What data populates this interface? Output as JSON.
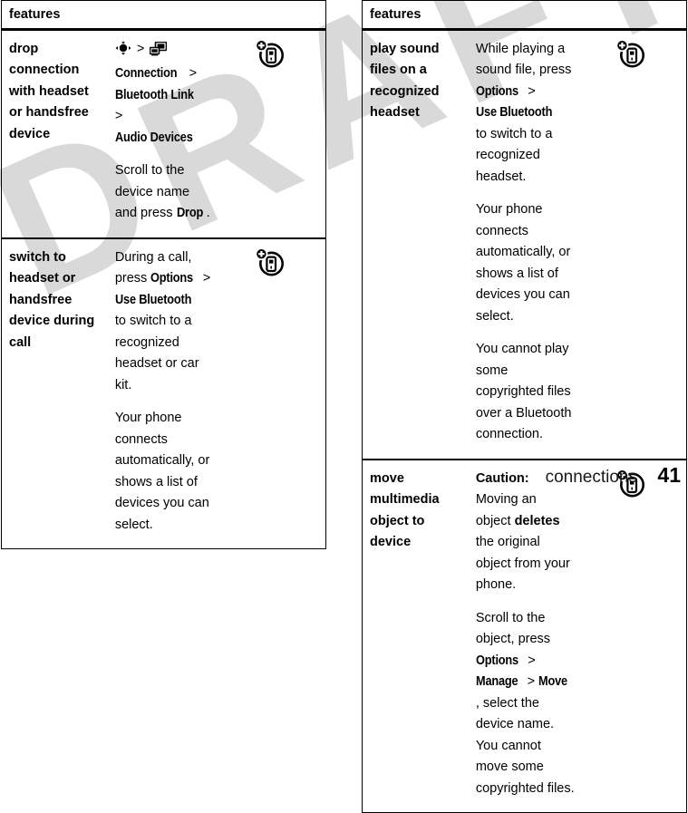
{
  "document": {
    "watermark_text": "DRAFT",
    "watermark_color": "#d9d9d9"
  },
  "footer": {
    "chapter": "connections",
    "page_number": "41"
  },
  "left_table": {
    "header": "features",
    "rows": [
      {
        "term": "drop connection with headset or handsfree device",
        "icon": "phone-plus-icon",
        "paragraphs": [
          {
            "segments": [
              {
                "type": "icon",
                "name": "navigation-key-icon"
              },
              {
                "type": "plain",
                "text": " > "
              },
              {
                "type": "icon",
                "name": "connection-icon"
              },
              {
                "type": "ui",
                "text": "Connection"
              },
              {
                "type": "plain",
                "text": " "
              },
              {
                "type": "plain",
                "text": "> "
              },
              {
                "type": "ui",
                "text": "Bluetooth Link"
              },
              {
                "type": "plain",
                "text": " > "
              },
              {
                "type": "ui",
                "text": "Audio Devices"
              }
            ]
          },
          {
            "segments": [
              {
                "type": "plain",
                "text": "Scroll to the device name and press "
              },
              {
                "type": "ui",
                "text": "Drop"
              },
              {
                "type": "plain",
                "text": "."
              }
            ]
          }
        ]
      },
      {
        "term": "switch to headset or handsfree device during call",
        "icon": "phone-plus-icon",
        "paragraphs": [
          {
            "segments": [
              {
                "type": "plain",
                "text": "During a call, press "
              },
              {
                "type": "ui",
                "text": "Options"
              },
              {
                "type": "plain",
                "text": " > "
              },
              {
                "type": "ui",
                "text": "Use Bluetooth"
              },
              {
                "type": "plain",
                "text": " to switch to a recognized headset or car kit."
              }
            ]
          },
          {
            "segments": [
              {
                "type": "plain",
                "text": "Your phone connects automatically, or shows a list of devices you can select."
              }
            ]
          }
        ]
      }
    ]
  },
  "right_table": {
    "header": "features",
    "rows": [
      {
        "term": "play sound files on a recognized headset",
        "icon": "phone-plus-icon",
        "paragraphs": [
          {
            "segments": [
              {
                "type": "plain",
                "text": "While playing a sound file, press "
              },
              {
                "type": "ui",
                "text": "Options"
              },
              {
                "type": "plain",
                "text": " > "
              },
              {
                "type": "ui",
                "text": "Use Bluetooth"
              },
              {
                "type": "plain",
                "text": " to switch to a recognized headset."
              }
            ]
          },
          {
            "segments": [
              {
                "type": "plain",
                "text": "Your phone connects automatically, or shows a list of devices you can select."
              }
            ]
          },
          {
            "segments": [
              {
                "type": "plain",
                "text": "You cannot play some copyrighted files over a Bluetooth connection."
              }
            ]
          }
        ]
      },
      {
        "term": "move multimedia object to device",
        "icon": "phone-plus-icon",
        "paragraphs": [
          {
            "segments": [
              {
                "type": "bold",
                "text": "Caution:"
              },
              {
                "type": "plain",
                "text": " Moving an object "
              },
              {
                "type": "bold",
                "text": "deletes"
              },
              {
                "type": "plain",
                "text": " the original object from your phone."
              }
            ]
          },
          {
            "segments": [
              {
                "type": "plain",
                "text": "Scroll to the object, press "
              },
              {
                "type": "ui",
                "text": "Options"
              },
              {
                "type": "plain",
                "text": " > "
              },
              {
                "type": "ui",
                "text": "Manage"
              },
              {
                "type": "plain",
                "text": " > "
              },
              {
                "type": "ui",
                "text": "Move"
              },
              {
                "type": "plain",
                "text": ", select the device name. You cannot move some copyrighted files."
              }
            ]
          }
        ]
      }
    ]
  }
}
